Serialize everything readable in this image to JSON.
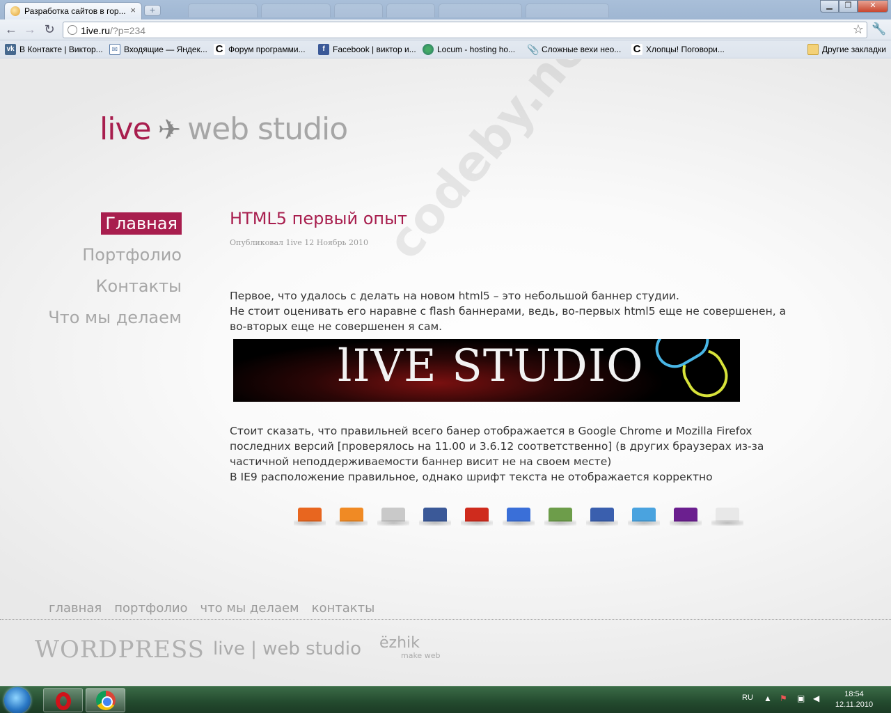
{
  "browser": {
    "tab_title": "Разработка сайтов в гор...",
    "tab_close": "×",
    "new_tab": "+",
    "url_host": "1ive.ru",
    "url_path": "/?p=234",
    "bookmarks": [
      {
        "label": "В Контакте | Виктор...",
        "icon": "vk-icon",
        "glyph": "vk"
      },
      {
        "label": "Входящие — Яндек...",
        "icon": "mail-icon",
        "glyph": "✉"
      },
      {
        "label": "Форум программи...",
        "icon": "c-icon",
        "glyph": "C"
      },
      {
        "label": "Facebook | виктор и...",
        "icon": "facebook-icon",
        "glyph": "f"
      },
      {
        "label": "Locum - hosting ho...",
        "icon": "locum-icon",
        "glyph": ""
      },
      {
        "label": "Сложные вехи нео...",
        "icon": "paperclip-icon",
        "glyph": "📎"
      },
      {
        "label": "Хлопцы! Поговори...",
        "icon": "c-icon",
        "glyph": "C"
      }
    ],
    "other_bookmarks": "Другие закладки"
  },
  "site": {
    "logo_live": "live",
    "logo_ws": "web studio",
    "nav": [
      "Главная",
      "Портфолио",
      "Контакты",
      "Что мы делаем"
    ],
    "post": {
      "title": "HTML5 первый опыт",
      "meta": "Опубликовал 1ive 12 Ноябрь 2010",
      "p1_l1": "Первое, что удалось с делать на новом html5 – это небольшой баннер студии.",
      "p1_l2": "Не стоит оценивать его наравне с flash баннерами, ведь, во-первых html5 еще не совершенен, а во-вторых еще не совершенен я сам.",
      "banner_text": "lIVE STUDIO",
      "p2_l1": "Стоит сказать, что правильней всего банер отображается в Google Chrome и Mozilla Firefox последних версий [проверялось на 11.00 и 3.6.12 соответственно] (в других браузерах из-за частичной неподдерживаемости баннер висит не на своем месте)",
      "p2_l2": "В IE9 расположение правильное, однако шрифт текста не отображается корректно"
    },
    "share_icons": [
      "blogger-icon",
      "rss-icon",
      "print-icon",
      "facebook-icon",
      "gmail-icon",
      "google-buzz-icon",
      "google-bookmarks-icon",
      "myspace-icon",
      "twitter-icon",
      "yahoo-icon",
      "yandex-icon"
    ],
    "share_colors": [
      "#e8661f",
      "#f08a24",
      "#c9c9c9",
      "#3b5998",
      "#cf2b1d",
      "#3a6fd8",
      "#6d9d4a",
      "#3a5fae",
      "#4aa3df",
      "#6b1f8f",
      "#e8e8e8"
    ],
    "watermark": "codeby.net",
    "footer_nav": [
      "главная",
      "портфолио",
      "что мы делаем",
      "контакты"
    ],
    "footer_wordpress": "WORDPRESS",
    "footer_logo": "live | web studio",
    "footer_ezhik": "ëzhik",
    "footer_ezhik_sub": "make web"
  },
  "taskbar": {
    "lang": "RU",
    "time": "18:54",
    "date": "12.11.2010"
  }
}
